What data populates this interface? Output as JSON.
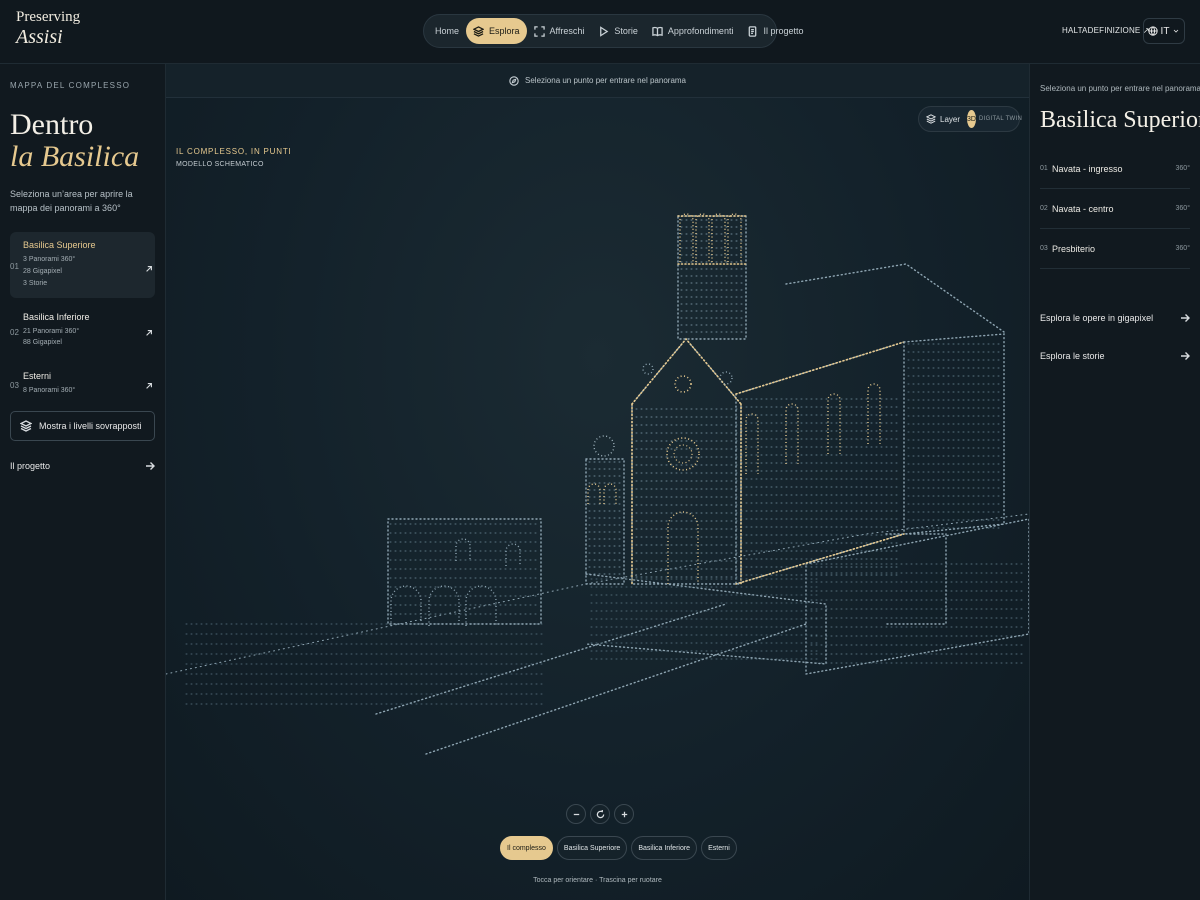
{
  "header": {
    "brand_line1": "Preserving",
    "brand_line2": "Assisi",
    "nav": [
      {
        "label": "Home",
        "icon": "none",
        "active": false
      },
      {
        "label": "Esplora",
        "icon": "layers-icon",
        "active": true
      },
      {
        "label": "Affreschi",
        "icon": "frame-icon",
        "active": false
      },
      {
        "label": "Storie",
        "icon": "play-icon",
        "active": false
      },
      {
        "label": "Approfondimenti",
        "icon": "book-icon",
        "active": false
      },
      {
        "label": "Il progetto",
        "icon": "document-icon",
        "active": false
      }
    ],
    "hd_link": "HALTADEFINIZIONE ↗",
    "language": "IT"
  },
  "left": {
    "eyebrow": "MAPPA DEL COMPLESSO",
    "title_line1": "Dentro",
    "title_line2": "la Basilica",
    "intro": "Seleziona un’area per aprire la mappa dei panorami a 360°",
    "areas": [
      {
        "num": "01",
        "name": "Basilica Superiore",
        "meta": [
          "3 Panorami 360°",
          "28 Gigapixel",
          "3 Storie"
        ],
        "active": true
      },
      {
        "num": "02",
        "name": "Basilica Inferiore",
        "meta": [
          "21 Panorami 360°",
          "88 Gigapixel"
        ],
        "active": false
      },
      {
        "num": "03",
        "name": "Esterni",
        "meta": [
          "8 Panorami 360°"
        ],
        "active": false
      }
    ],
    "layers_button": "Mostra i livelli sovrapposti",
    "project_link": "Il progetto"
  },
  "center": {
    "hint": "Seleziona un punto per entrare nel panorama",
    "toggle": {
      "layer": "Layer",
      "mode": "3D",
      "alt": "DIGITAL TWIN"
    },
    "scene_title": "IL COMPLESSO, IN PUNTI",
    "scene_subtitle": "MODELLO SCHEMATICO",
    "chips": [
      {
        "label": "Il complesso",
        "active": true
      },
      {
        "label": "Basilica Superiore",
        "active": false
      },
      {
        "label": "Basilica Inferiore",
        "active": false
      },
      {
        "label": "Esterni",
        "active": false
      }
    ],
    "footer_hint": "Tocca per orientare · Trascina per ruotare",
    "colors": {
      "accent": "#e6c98f",
      "dot": "#8fa6b3"
    }
  },
  "right": {
    "hint": "Seleziona un punto per entrare nel panorama",
    "title": "Basilica Superiore",
    "items": [
      {
        "num": "01",
        "label": "Navata - ingresso",
        "tag": "360°"
      },
      {
        "num": "02",
        "label": "Navata - centro",
        "tag": "360°"
      },
      {
        "num": "03",
        "label": "Presbiterio",
        "tag": "360°"
      }
    ],
    "links": [
      "Esplora le opere in gigapixel",
      "Esplora le storie"
    ]
  }
}
